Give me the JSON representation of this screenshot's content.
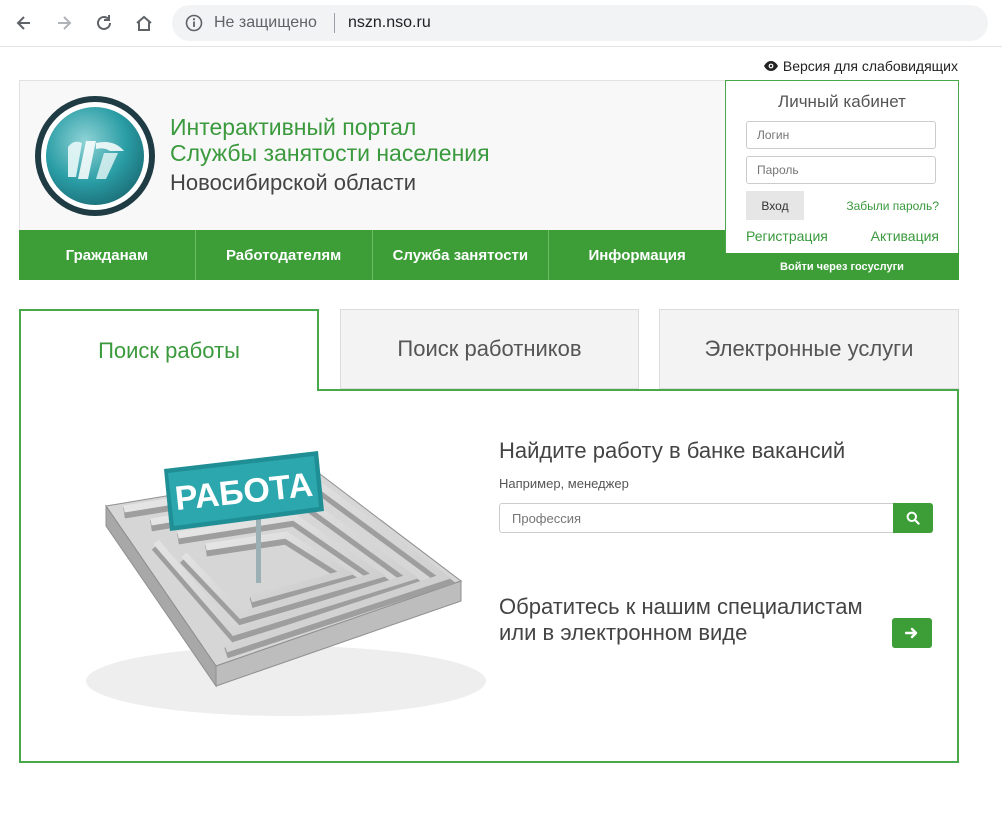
{
  "browser": {
    "security_text": "Не защищено",
    "url": "nszn.nso.ru"
  },
  "accessibility_link": "Версия для слабовидящих",
  "header": {
    "title_line1": "Интерактивный портал",
    "title_line2": "Службы занятости населения",
    "title_line3": "Новосибирской области"
  },
  "nav": {
    "items": [
      "Гражданам",
      "Работодателям",
      "Служба занятости",
      "Информация"
    ]
  },
  "cabinet": {
    "title": "Личный кабинет",
    "login_placeholder": "Логин",
    "password_placeholder": "Пароль",
    "enter_label": "Вход",
    "forgot_label": "Забыли пароль?",
    "register_label": "Регистрация",
    "activate_label": "Активация",
    "gosuslugi_label": "Войти через госуслуги"
  },
  "tabs": [
    "Поиск работы",
    "Поиск работников",
    "Электронные услуги"
  ],
  "search": {
    "image_sign": "РАБОТА",
    "title": "Найдите работу в банке вакансий",
    "hint": "Например, менеджер",
    "placeholder": "Профессия"
  },
  "contact": {
    "line1": "Обратитесь к нашим специалистам",
    "line2": "или в электронном виде"
  },
  "colors": {
    "brand_green": "#3d9e38",
    "border_green": "#48a84a",
    "logo_teal": "#2a9da5"
  },
  "icons": [
    "back-arrow-icon",
    "forward-arrow-icon",
    "reload-icon",
    "home-icon",
    "info-icon",
    "eye-icon",
    "search-icon",
    "arrow-right-icon"
  ]
}
